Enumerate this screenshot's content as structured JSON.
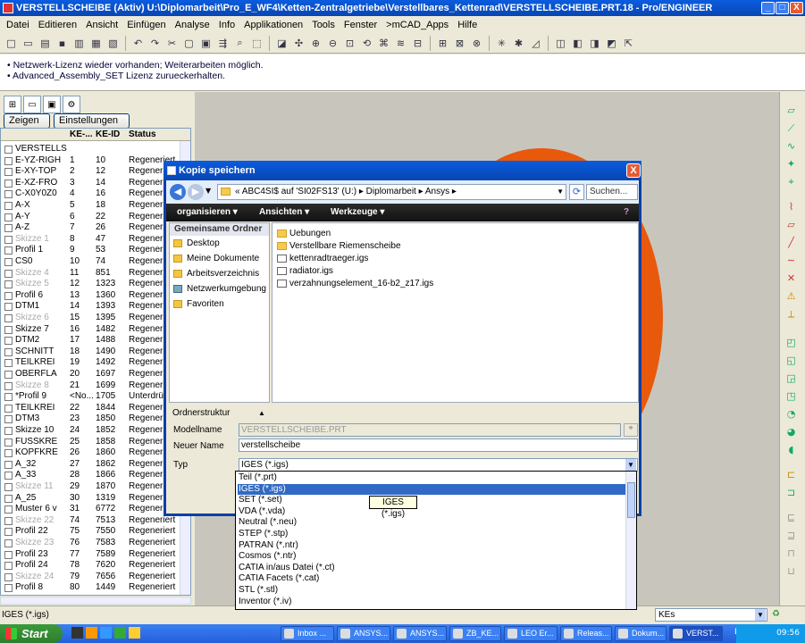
{
  "window": {
    "title": "VERSTELLSCHEIBE (Aktiv) U:\\Diplomarbeit\\Pro_E_WF4\\Ketten-Zentralgetriebe\\Verstellbares_Kettenrad\\VERSTELLSCHEIBE.PRT.18 - Pro/ENGINEER",
    "btn_min": "_",
    "btn_max": "□",
    "btn_close": "X"
  },
  "menu": [
    "Datei",
    "Editieren",
    "Ansicht",
    "Einfügen",
    "Analyse",
    "Info",
    "Applikationen",
    "Tools",
    "Fenster",
    ">mCAD_Apps",
    "Hilfe"
  ],
  "messages": [
    "• Netzwerk-Lizenz wieder vorhanden; Weiterarbeiten möglich.",
    "• Advanced_Assembly_SET Lizenz zurueckerhalten."
  ],
  "left": {
    "zeigen": "Zeigen ▾",
    "einstellungen": "Einstellungen ▾",
    "col_ke": "KE-...",
    "col_keid": "KE-ID",
    "col_status": "Status",
    "rows": [
      {
        "name": "VERSTELLSC",
        "k1": "",
        "k2": "",
        "st": ""
      },
      {
        "name": "E-YZ-RIGH",
        "k1": "1",
        "k2": "10",
        "st": "Regeneriert"
      },
      {
        "name": "E-XY-TOP",
        "k1": "2",
        "k2": "12",
        "st": "Regeneriert"
      },
      {
        "name": "E-XZ-FRO",
        "k1": "3",
        "k2": "14",
        "st": "Regeneriert"
      },
      {
        "name": "C-X0Y0Z0",
        "k1": "4",
        "k2": "16",
        "st": "Regeneriert"
      },
      {
        "name": "A-X",
        "k1": "5",
        "k2": "18",
        "st": "Regeneriert"
      },
      {
        "name": "A-Y",
        "k1": "6",
        "k2": "22",
        "st": "Regeneriert"
      },
      {
        "name": "A-Z",
        "k1": "7",
        "k2": "26",
        "st": "Regeneriert"
      },
      {
        "name": "Skizze 1",
        "k1": "8",
        "k2": "47",
        "st": "Regeneriert",
        "dim": true
      },
      {
        "name": "Profil 1",
        "k1": "9",
        "k2": "53",
        "st": "Regeneriert"
      },
      {
        "name": "CS0",
        "k1": "10",
        "k2": "74",
        "st": "Regeneriert"
      },
      {
        "name": "Skizze 4",
        "k1": "11",
        "k2": "851",
        "st": "Regeneriert",
        "dim": true
      },
      {
        "name": "Skizze 5",
        "k1": "12",
        "k2": "1323",
        "st": "Regeneriert",
        "dim": true
      },
      {
        "name": "Profil 6",
        "k1": "13",
        "k2": "1360",
        "st": "Regeneriert"
      },
      {
        "name": "DTM1",
        "k1": "14",
        "k2": "1393",
        "st": "Regeneriert"
      },
      {
        "name": "Skizze 6",
        "k1": "15",
        "k2": "1395",
        "st": "Regeneriert",
        "dim": true
      },
      {
        "name": "Skizze 7",
        "k1": "16",
        "k2": "1482",
        "st": "Regeneriert"
      },
      {
        "name": "DTM2",
        "k1": "17",
        "k2": "1488",
        "st": "Regeneriert"
      },
      {
        "name": "SCHNITT",
        "k1": "18",
        "k2": "1490",
        "st": "Regeneriert"
      },
      {
        "name": "TEILKREI",
        "k1": "19",
        "k2": "1492",
        "st": "Regeneriert"
      },
      {
        "name": "OBERFLA",
        "k1": "20",
        "k2": "1697",
        "st": "Regeneriert"
      },
      {
        "name": "Skizze 8",
        "k1": "21",
        "k2": "1699",
        "st": "Regeneriert",
        "dim": true
      },
      {
        "name": "*Profil 9",
        "k1": "<No...",
        "k2": "1705",
        "st": "Unterdrü"
      },
      {
        "name": "TEILKREI",
        "k1": "22",
        "k2": "1844",
        "st": "Regeneriert"
      },
      {
        "name": "DTM3",
        "k1": "23",
        "k2": "1850",
        "st": "Regeneriert"
      },
      {
        "name": "Skizze 10",
        "k1": "24",
        "k2": "1852",
        "st": "Regeneriert"
      },
      {
        "name": "FUSSKRE",
        "k1": "25",
        "k2": "1858",
        "st": "Regeneriert"
      },
      {
        "name": "KOPFKRE",
        "k1": "26",
        "k2": "1860",
        "st": "Regeneriert"
      },
      {
        "name": "A_32",
        "k1": "27",
        "k2": "1862",
        "st": "Regeneriert"
      },
      {
        "name": "A_33",
        "k1": "28",
        "k2": "1866",
        "st": "Regeneriert"
      },
      {
        "name": "Skizze 11",
        "k1": "29",
        "k2": "1870",
        "st": "Regeneriert",
        "dim": true
      },
      {
        "name": "A_25",
        "k1": "30",
        "k2": "1319",
        "st": "Regeneriert"
      },
      {
        "name": "Muster 6 v",
        "k1": "31",
        "k2": "6772",
        "st": "Regeneriert"
      },
      {
        "name": "Skizze 22",
        "k1": "74",
        "k2": "7513",
        "st": "Regeneriert",
        "dim": true
      },
      {
        "name": "Profil 22",
        "k1": "75",
        "k2": "7550",
        "st": "Regeneriert"
      },
      {
        "name": "Skizze 23",
        "k1": "76",
        "k2": "7583",
        "st": "Regeneriert",
        "dim": true
      },
      {
        "name": "Profil 23",
        "k1": "77",
        "k2": "7589",
        "st": "Regeneriert"
      },
      {
        "name": "Profil 24",
        "k1": "78",
        "k2": "7620",
        "st": "Regeneriert"
      },
      {
        "name": "Skizze 24",
        "k1": "79",
        "k2": "7656",
        "st": "Regeneriert",
        "dim": true
      },
      {
        "name": "Profil 8",
        "k1": "80",
        "k2": "1449",
        "st": "Regeneriert"
      }
    ]
  },
  "dialog": {
    "title": "Kopie speichern",
    "close": "X",
    "address": "« ABC4SI$ auf 'SI02FS13' (U:) ▸ Diplomarbeit ▸ Ansys ▸",
    "search_placeholder": "Suchen...",
    "cmd_organize": "organisieren ▾",
    "cmd_views": "Ansichten ▾",
    "cmd_tools": "Werkzeuge ▾",
    "nav_header": "Gemeinsame Ordner",
    "nav_items": [
      "Desktop",
      "Meine Dokumente",
      "Arbeitsverzeichnis",
      "Netzwerkumgebung",
      "Favoriten"
    ],
    "files": [
      {
        "name": "Uebungen",
        "type": "folder"
      },
      {
        "name": "Verstellbare Riemenscheibe",
        "type": "folder"
      },
      {
        "name": "kettenradtraeger.igs",
        "type": "doc"
      },
      {
        "name": "radiator.igs",
        "type": "doc"
      },
      {
        "name": "verzahnungselement_16-b2_z17.igs",
        "type": "doc"
      }
    ],
    "ordnerstruktur": "Ordnerstruktur",
    "modellname_label": "Modellname",
    "modellname_value": "VERSTELLSCHEIBE.PRT",
    "neuer_name_label": "Neuer Name",
    "neuer_name_value": "verstellscheibe",
    "typ_label": "Typ",
    "typ_value": "IGES (*.igs)"
  },
  "dropdown_options": [
    "Teil (*.prt)",
    "IGES (*.igs)",
    "SET (*.set)",
    "VDA (*.vda)",
    "Neutral (*.neu)",
    "STEP (*.stp)",
    "PATRAN (*.ntr)",
    "Cosmos (*.ntr)",
    "CATIA in/aus Datei (*.ct)",
    "CATIA Facets (*.cat)",
    "STL (*.stl)",
    "Inventor (*.iv)"
  ],
  "tooltip": "IGES (*.igs)",
  "status": {
    "left": "IGES (*.igs)",
    "filter": "KEs"
  },
  "taskbar": {
    "start": "Start",
    "tasks": [
      "Inbox ...",
      "ANSYS...",
      "ANSYS...",
      "ZB_KE...",
      "LEO Er...",
      "Releas...",
      "Dokum...",
      "VERST..."
    ],
    "lang": "DE",
    "clock": "09:56"
  }
}
